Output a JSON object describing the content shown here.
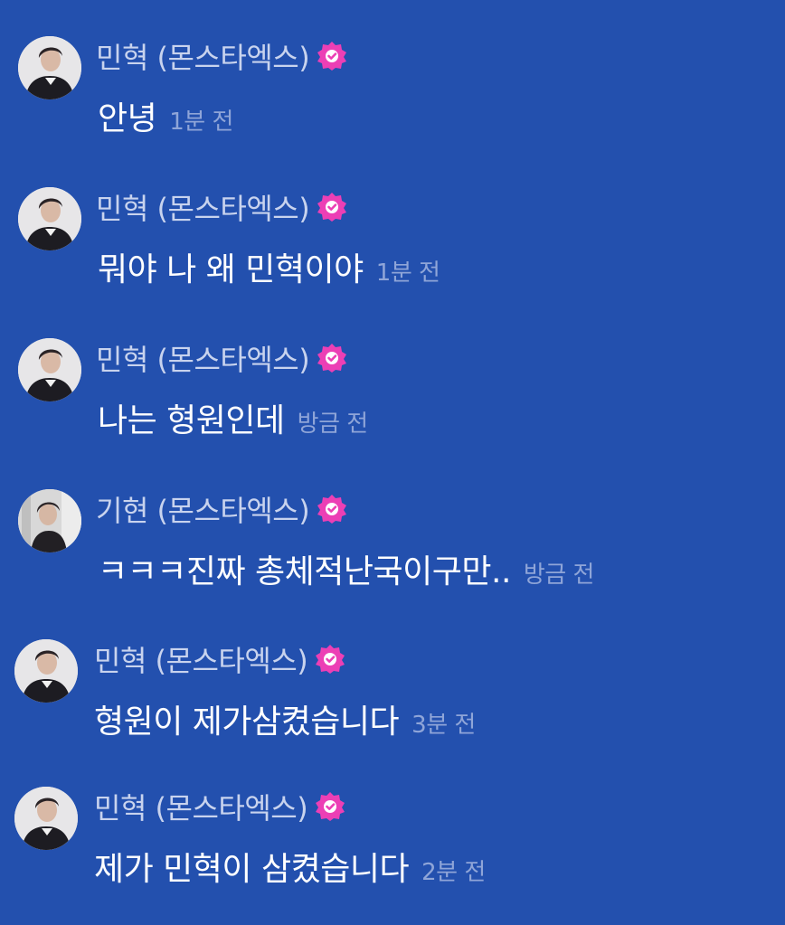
{
  "messages": [
    {
      "author": "민혁 (몬스타엑스)",
      "text": "안녕",
      "time": "1분 전",
      "avatar": "minhyuk-avatar"
    },
    {
      "author": "민혁 (몬스타엑스)",
      "text": "뭐야 나 왜 민혁이야",
      "time": "1분 전",
      "avatar": "minhyuk-avatar"
    },
    {
      "author": "민혁 (몬스타엑스)",
      "text": "나는 형원인데",
      "time": "방금 전",
      "avatar": "minhyuk-avatar"
    },
    {
      "author": "기현 (몬스타엑스)",
      "text": "ㅋㅋㅋ진짜 총체적난국이구만..",
      "time": "방금 전",
      "avatar": "kihyun-avatar"
    },
    {
      "author": "민혁 (몬스타엑스)",
      "text": "형원이 제가삼켰습니다",
      "time": "3분 전",
      "avatar": "minhyuk-avatar"
    },
    {
      "author": "민혁 (몬스타엑스)",
      "text": "제가 민혁이 삼켰습니다",
      "time": "2분 전",
      "avatar": "minhyuk-avatar"
    }
  ],
  "colors": {
    "background": "#2350AE",
    "verified_badge": "#EC3FB5",
    "name_text": "#C8D3EE",
    "time_text": "#8FA5D8"
  },
  "icons": {
    "verified": "verified-badge-icon"
  }
}
